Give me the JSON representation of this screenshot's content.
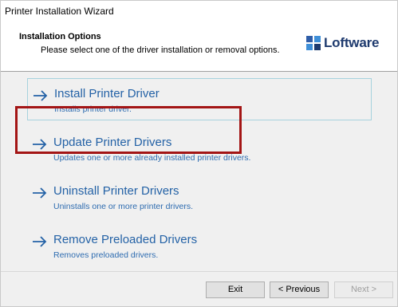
{
  "window": {
    "title": "Printer Installation Wizard"
  },
  "header": {
    "title": "Installation Options",
    "subtitle": "Please select one of the driver installation or removal options.",
    "logo_text": "Loftware"
  },
  "options": [
    {
      "title": "Install Printer Driver",
      "description": "Installs printer driver."
    },
    {
      "title": "Update Printer Drivers",
      "description": "Updates one or more already installed printer drivers."
    },
    {
      "title": "Uninstall Printer Drivers",
      "description": "Uninstalls one or more printer drivers."
    },
    {
      "title": "Remove Preloaded Drivers",
      "description": "Removes preloaded drivers."
    }
  ],
  "buttons": {
    "exit": "Exit",
    "previous": "< Previous",
    "next": "Next >"
  },
  "colors": {
    "option_title": "#2462a6",
    "highlight": "#a31515",
    "brand": "#1e3a6e"
  }
}
